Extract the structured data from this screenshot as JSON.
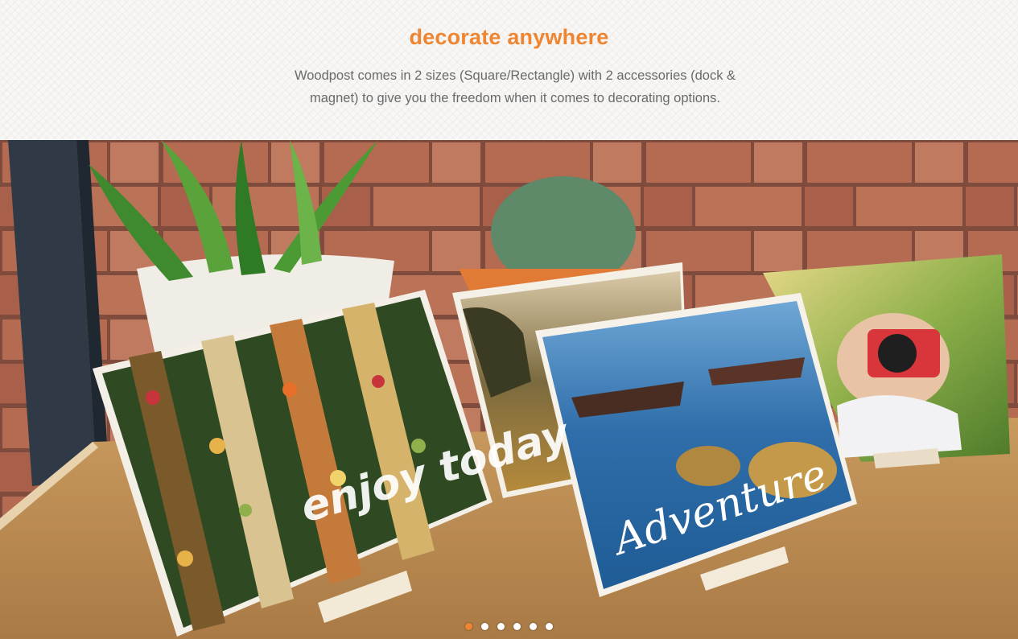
{
  "section": {
    "title": "decorate anywhere",
    "description": "Woodpost comes in 2 sizes (Square/Rectangle) with 2 accessories (dock & magnet) to give you the freedom when it comes to decorating options."
  },
  "slideshow": {
    "active_index": 0,
    "slide_count": 6,
    "photo_texts": {
      "left_card": "enjoy today",
      "front_card": "Adventure"
    }
  },
  "colors": {
    "accent": "#ef8530",
    "text": "#6a6a6a",
    "dot_inactive": "#ffffff"
  }
}
